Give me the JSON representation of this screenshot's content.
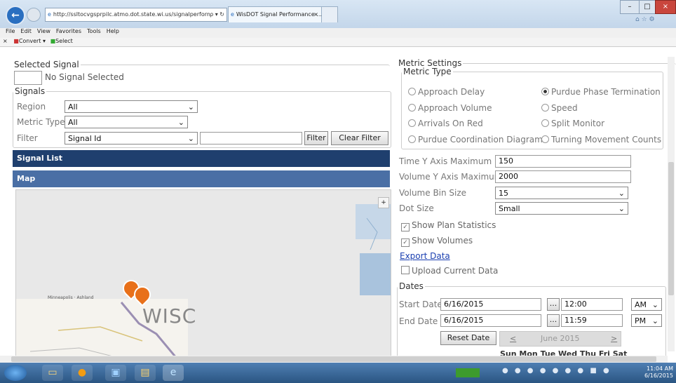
{
  "browser": {
    "address": "http://ssltocvgsprpilc.atmo.dot.state.wi.us/signalperforma",
    "address_icons": "ρ ▾ ↻",
    "tab_title": "WisDOT Signal Performance ...",
    "tab_close": "×",
    "back": "←"
  },
  "menu": [
    "File",
    "Edit",
    "View",
    "Favorites",
    "Tools",
    "Help"
  ],
  "cmdbar": {
    "close": "×",
    "convert": "Convert",
    "select": "Select"
  },
  "selected_signal": {
    "legend": "Selected Signal",
    "value": "",
    "text": "No Signal Selected"
  },
  "signals": {
    "legend": "Signals",
    "region_label": "Region",
    "region_value": "All",
    "metric_type_label": "Metric Type",
    "metric_type_value": "All",
    "filter_label": "Filter",
    "filter_value": "Signal Id",
    "filter_text": "",
    "filter_button": "Filter",
    "clear_filter_button": "Clear Filter"
  },
  "signal_list_header": "Signal List",
  "map": {
    "header": "Map",
    "label_wisc": "WISC",
    "label_city": "Minneapolis   ·   Ashland"
  },
  "metric_settings": {
    "legend": "Metric Settings",
    "metric_type_legend": "Metric Type",
    "options": [
      {
        "label": "Approach Delay",
        "checked": false
      },
      {
        "label": "Purdue Phase Termination",
        "checked": true
      },
      {
        "label": "Approach Volume",
        "checked": false
      },
      {
        "label": "Speed",
        "checked": false
      },
      {
        "label": "Arrivals On Red",
        "checked": false
      },
      {
        "label": "Split Monitor",
        "checked": false
      },
      {
        "label": "Purdue Coordination Diagram",
        "checked": false
      },
      {
        "label": "Turning Movement Counts",
        "checked": false
      }
    ]
  },
  "settings": {
    "time_y_label": "Time Y Axis Maximum",
    "time_y_value": "150",
    "volume_y_label": "Volume Y Axis Maximum",
    "volume_y_value": "2000",
    "bin_label": "Volume Bin Size",
    "bin_value": "15",
    "dot_label": "Dot Size",
    "dot_value": "Small",
    "show_plan": "Show Plan Statistics",
    "show_volumes": "Show Volumes",
    "export": "Export Data",
    "upload": "Upload Current Data"
  },
  "dates": {
    "legend": "Dates",
    "start_label": "Start Date",
    "start_date": "6/16/2015",
    "start_time": "12:00",
    "start_ampm": "AM",
    "end_label": "End Date",
    "end_date": "6/16/2015",
    "end_time": "11:59",
    "end_ampm": "PM",
    "picker_btn": "...",
    "reset_button": "Reset Date",
    "cal_prev": "<",
    "cal_month": "June 2015",
    "cal_next": ">",
    "weekdays": "Sun Mon Tue Wed Thu Fri Sat"
  },
  "tray": {
    "time": "11:04 AM",
    "date": "6/16/2015"
  },
  "colors": {
    "bar_blue": "#1f3f6e",
    "map_bar": "#4a6fa5",
    "pin": "#e8701a"
  }
}
